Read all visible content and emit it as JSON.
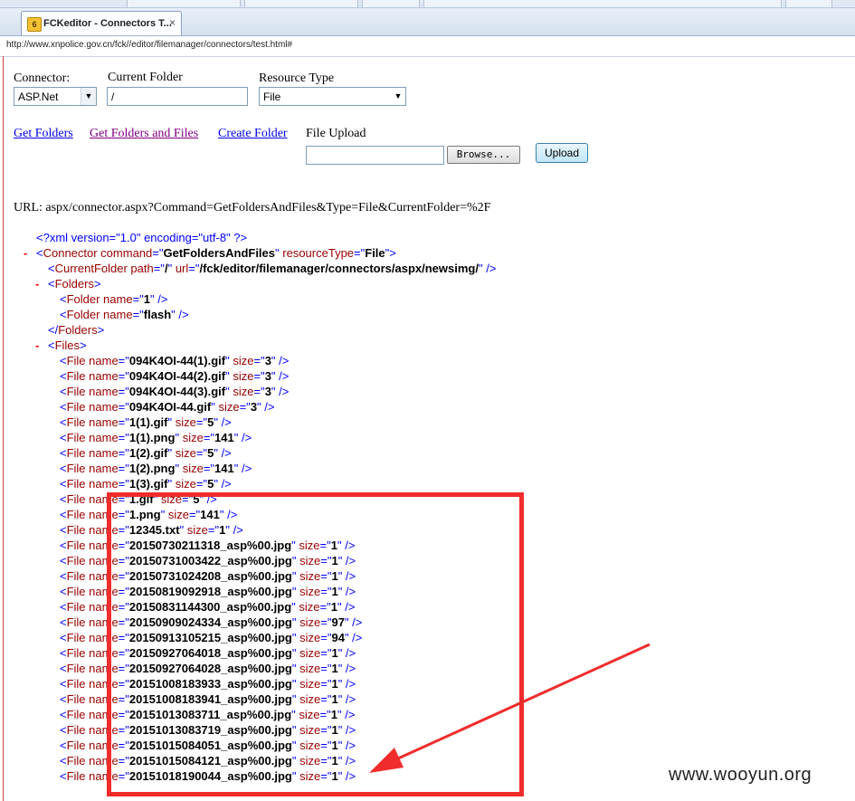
{
  "browser": {
    "tab_title": "FCKeditor - Connectors T...",
    "tab_close": "×",
    "tab_icon_glyph": "6",
    "address": "http://www.xnpolice.gov.cn/fck//editor/filemanager/connectors/test.html#"
  },
  "form": {
    "connector_label": "Connector:",
    "connector_value": "ASP.Net",
    "current_folder_label": "Current Folder",
    "current_folder_value": "/",
    "resource_type_label": "Resource Type",
    "resource_type_value": "File",
    "dropdown_glyph": "▼"
  },
  "actions": {
    "get_folders": "Get Folders",
    "get_folders_and_files": "Get Folders and Files",
    "create_folder": "Create Folder",
    "file_upload_label": "File Upload",
    "browse_button": "Browse...",
    "upload_button": "Upload"
  },
  "url_line": "URL: aspx/connector.aspx?Command=GetFoldersAndFiles&Type=File&CurrentFolder=%2F",
  "xml": {
    "minus": "-",
    "declaration": "<?xml version=\"1.0\" encoding=\"utf-8\" ?>",
    "connector": {
      "command": "GetFoldersAndFiles",
      "resourceType": "File"
    },
    "current_folder": {
      "path": "/",
      "url": "/fck/editor/filemanager/connectors/aspx/newsimg/"
    },
    "folders": [
      "1",
      "flash"
    ],
    "files": [
      {
        "name": "094K4OI-44(1).gif",
        "size": "3"
      },
      {
        "name": "094K4OI-44(2).gif",
        "size": "3"
      },
      {
        "name": "094K4OI-44(3).gif",
        "size": "3"
      },
      {
        "name": "094K4OI-44.gif",
        "size": "3"
      },
      {
        "name": "1(1).gif",
        "size": "5"
      },
      {
        "name": "1(1).png",
        "size": "141"
      },
      {
        "name": "1(2).gif",
        "size": "5"
      },
      {
        "name": "1(2).png",
        "size": "141"
      },
      {
        "name": "1(3).gif",
        "size": "5"
      },
      {
        "name": "1.gif",
        "size": "5"
      },
      {
        "name": "1.png",
        "size": "141"
      },
      {
        "name": "12345.txt",
        "size": "1"
      },
      {
        "name": "20150730211318_asp%00.jpg",
        "size": "1"
      },
      {
        "name": "20150731003422_asp%00.jpg",
        "size": "1"
      },
      {
        "name": "20150731024208_asp%00.jpg",
        "size": "1"
      },
      {
        "name": "20150819092918_asp%00.jpg",
        "size": "1"
      },
      {
        "name": "20150831144300_asp%00.jpg",
        "size": "1"
      },
      {
        "name": "20150909024334_asp%00.jpg",
        "size": "97"
      },
      {
        "name": "20150913105215_asp%00.jpg",
        "size": "94"
      },
      {
        "name": "20150927064018_asp%00.jpg",
        "size": "1"
      },
      {
        "name": "20150927064028_asp%00.jpg",
        "size": "1"
      },
      {
        "name": "20151008183933_asp%00.jpg",
        "size": "1"
      },
      {
        "name": "20151008183941_asp%00.jpg",
        "size": "1"
      },
      {
        "name": "20151013083711_asp%00.jpg",
        "size": "1"
      },
      {
        "name": "20151013083719_asp%00.jpg",
        "size": "1"
      },
      {
        "name": "20151015084051_asp%00.jpg",
        "size": "1"
      },
      {
        "name": "20151015084121_asp%00.jpg",
        "size": "1"
      },
      {
        "name": "20151018190044_asp%00.jpg",
        "size": "1"
      }
    ]
  },
  "annotation": {
    "box_color": "#f02c2c",
    "arrow_color": "#f02c2c"
  },
  "watermark": "www.wooyun.org",
  "colors": {
    "tag": "#990000",
    "punct": "#0000ff",
    "value": "#000000",
    "minus": "#ff0000",
    "link": "#0000ee",
    "visited_link": "#800080"
  }
}
